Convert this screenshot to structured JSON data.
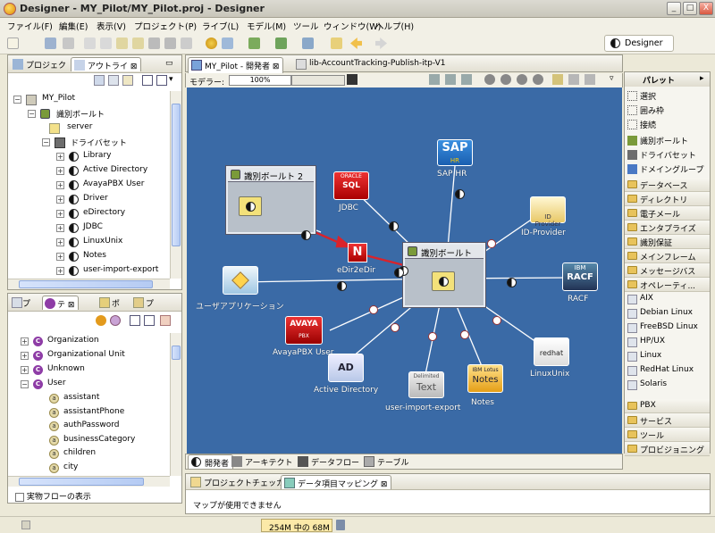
{
  "window": {
    "title": "Designer - MY_Pilot/MY_Pilot.proj - Designer",
    "min": "_",
    "max": "□",
    "close": "X"
  },
  "menu": [
    "ファイル(F)",
    "編集(E)",
    "表示(V)",
    "プロジェクト(P)",
    "ライブ(L)",
    "モデル(M)",
    "ツール",
    "ウィンドウ(W)",
    "ヘルプ(H)"
  ],
  "perspective": {
    "label": "Designer"
  },
  "left_top": {
    "tabs": [
      "プロジェク",
      "アウトライ"
    ],
    "tree": {
      "root": "MY_Pilot",
      "id_vault": "識別ボールト",
      "server": "server",
      "driverset": "ドライバセット",
      "drivers": [
        "Library",
        "Active Directory",
        "AvayaPBX User",
        "Driver",
        "eDirectory",
        "JDBC",
        "LinuxUnix",
        "Notes",
        "user-import-export"
      ]
    }
  },
  "left_bottom": {
    "tabs": [
      "プ",
      "テ",
      "ポ",
      "プ"
    ],
    "items": [
      "Organization",
      "Organizational Unit",
      "Unknown",
      "User"
    ],
    "attributes": [
      "assistant",
      "assistantPhone",
      "authPassword",
      "businessCategory",
      "children",
      "city"
    ],
    "checkbox_label": "実物フローの表示"
  },
  "editor": {
    "tabs": [
      "MY_Pilot - 開発者",
      "lib-AccountTracking-Publish-itp-V1"
    ],
    "modeler_label": "モデラー:",
    "zoom": "100%",
    "bottom_tabs": [
      "開発者",
      "アーキテクト",
      "データフロー",
      "テーブル"
    ]
  },
  "diagram": {
    "vault2_title": "識別ボールト 2",
    "vault_title": "識別ボールト",
    "nodes": {
      "sap": "SAP HR",
      "jdbc": "JDBC",
      "idprov": "ID-Provider",
      "edir": "eDir2eDir",
      "userapp": "ユーザアプリケーション",
      "racf": "RACF",
      "avaya": "AvayaPBX User",
      "ad": "Active Directory",
      "uie": "user-import-export",
      "notes": "Notes",
      "linuxunix": "LinuxUnix"
    },
    "logos": {
      "oracle_top": "ORACLE",
      "oracle_bottom": "SQL",
      "sap": "SAP",
      "sap_sub": "HR",
      "ibm": "IBM",
      "racf": "RACF",
      "avaya": "AVAYA",
      "avaya_sub": "PBX",
      "ad": "AD",
      "notes_top": "IBM Lotus",
      "notes_bottom": "Notes",
      "redhat": "redhat",
      "text_top": "Delimited",
      "text": "Text",
      "idprov": "ID Provider",
      "n_mark": "N"
    }
  },
  "palette": {
    "title": "パレット",
    "tools": [
      "選択",
      "囲み枠",
      "接続"
    ],
    "items": [
      "識別ボールト",
      "ドライバセット",
      "ドメイングループ"
    ],
    "drawers_top": [
      "データベース",
      "ディレクトリ",
      "電子メール",
      "エンタプライズ",
      "識別保証",
      "メインフレーム",
      "メッセージバス",
      "オペレーティ..."
    ],
    "os_items": [
      "AIX",
      "Debian Linux",
      "FreeBSD Linux",
      "HP/UX",
      "Linux",
      "RedHat Linux",
      "Solaris"
    ],
    "drawers_bottom": [
      "PBX",
      "サービス",
      "ツール",
      "プロビジョニング"
    ]
  },
  "bottom_panel": {
    "tabs": [
      "プロジェクトチェッカ",
      "データ項目マッピング"
    ],
    "message": "マップが使用できません"
  },
  "status": {
    "memory": "254M 中の 68M"
  },
  "colors": {
    "canvas": "#3a6aa6",
    "link_red": "#d9232b",
    "link_white": "#ffffff"
  }
}
